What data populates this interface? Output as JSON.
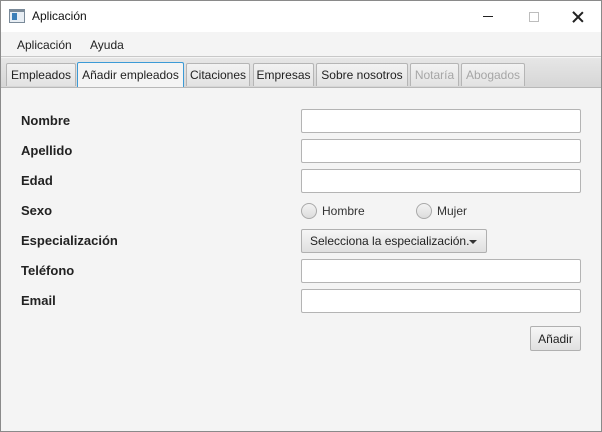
{
  "window": {
    "title": "Aplicación"
  },
  "menubar": {
    "items": [
      {
        "label": "Aplicación"
      },
      {
        "label": "Ayuda"
      }
    ]
  },
  "tabs": [
    {
      "label": "Empleados",
      "state": "normal"
    },
    {
      "label": "Añadir empleados",
      "state": "active"
    },
    {
      "label": "Citaciones",
      "state": "normal"
    },
    {
      "label": "Empresas",
      "state": "normal"
    },
    {
      "label": "Sobre nosotros",
      "state": "normal"
    },
    {
      "label": "Notaría",
      "state": "disabled"
    },
    {
      "label": "Abogados",
      "state": "disabled"
    }
  ],
  "form": {
    "fields": {
      "nombre": {
        "label": "Nombre",
        "value": ""
      },
      "apellido": {
        "label": "Apellido",
        "value": ""
      },
      "edad": {
        "label": "Edad",
        "value": ""
      },
      "sexo": {
        "label": "Sexo",
        "options": [
          "Hombre",
          "Mujer"
        ],
        "selected": ""
      },
      "especializacion": {
        "label": "Especialización",
        "selected": "Selecciona la especialización."
      },
      "telefono": {
        "label": "Teléfono",
        "value": ""
      },
      "email": {
        "label": "Email",
        "value": ""
      }
    },
    "submit_label": "Añadir"
  },
  "colors": {
    "focus_accent": "#3b9ad6",
    "background": "#f4f4f4"
  }
}
